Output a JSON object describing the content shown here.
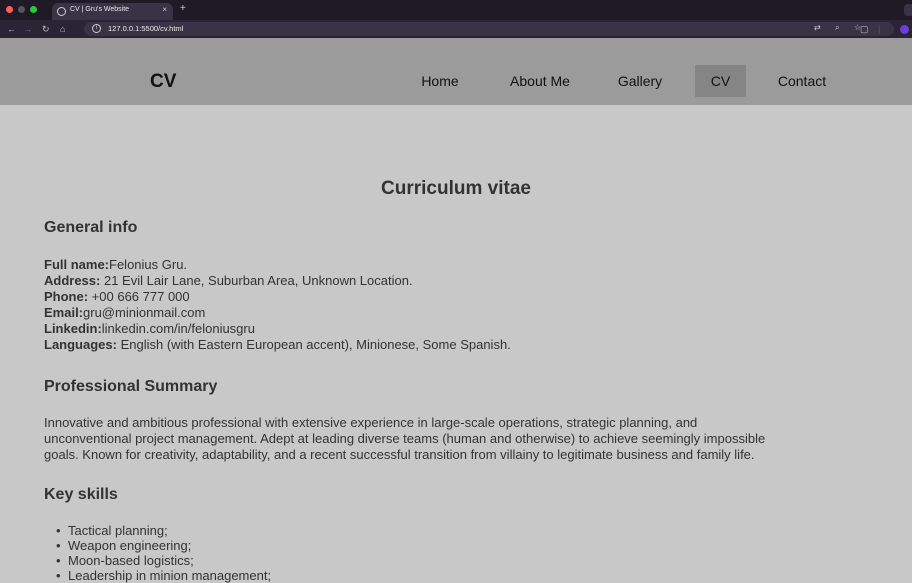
{
  "browser": {
    "tab_title": "CV | Gru's Website",
    "new_tab": "+",
    "url": "127.0.0.1:5500/cv.html"
  },
  "site": {
    "logo": "CV",
    "nav": [
      "Home",
      "About Me",
      "Gallery",
      "CV",
      "Contact"
    ],
    "active_nav": "CV"
  },
  "page": {
    "title": "Curriculum vitae",
    "general": {
      "heading": "General info",
      "full_name_label": "Full name:",
      "full_name": "Felonius Gru.",
      "address_label": "Address:",
      "address": " 21 Evil Lair Lane, Suburban Area, Unknown Location.",
      "phone_label": "Phone:",
      "phone": " +00 666 777 000",
      "email_label": "Email:",
      "email": "gru@minionmail.com",
      "linkedin_label": "Linkedin:",
      "linkedin": "linkedin.com/in/feloniusgru",
      "languages_label": "Languages:",
      "languages": " English (with Eastern European accent), Minionese, Some Spanish."
    },
    "summary": {
      "heading": "Professional Summary",
      "line1": "Innovative and ambitious professional with extensive experience in large-scale operations, strategic planning, and",
      "line2": "unconventional project management. Adept at leading diverse teams (human and otherwise) to achieve seemingly impossible",
      "line3": "goals. Known for creativity, adaptability, and a recent successful transition from villainy to legitimate business and family life."
    },
    "skills": {
      "heading": "Key skills",
      "items": [
        "Tactical planning;",
        "Weapon engineering;",
        "Moon-based logistics;",
        "Leadership in minion management;"
      ]
    }
  },
  "colors": {
    "page_bg": "#c8c8c8",
    "header_bg": "#9b9b9b",
    "active_nav_bg": "#858585",
    "text": "#333333"
  }
}
